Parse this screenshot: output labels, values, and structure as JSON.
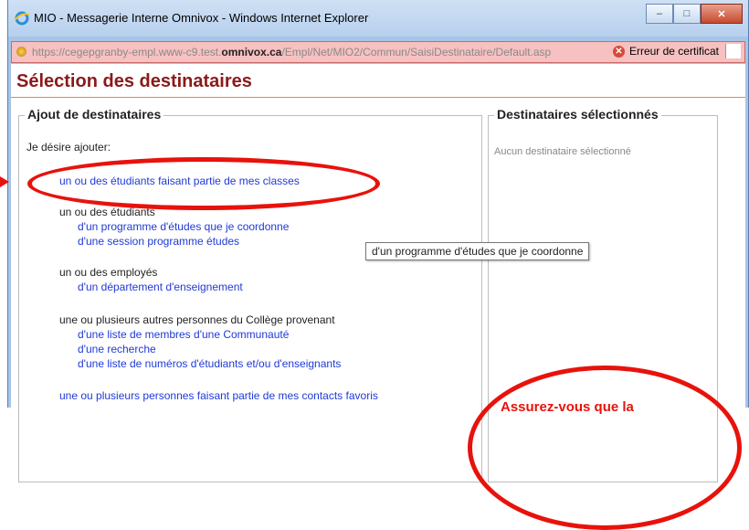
{
  "window": {
    "title": "MIO - Messagerie Interne Omnivox - Windows Internet Explorer",
    "controls": {
      "minimize": "–",
      "maximize": "□",
      "close": "✕"
    }
  },
  "address_bar": {
    "url_prefix": "https://cegepgranby-empl.www-c9.test.",
    "url_domain": "omnivox.ca",
    "url_suffix": "/Empl/Net/MIO2/Commun/SaisiDestinataire/Default.asp",
    "certificate_error": "Erreur de certificat"
  },
  "page": {
    "title": "Sélection des destinataires"
  },
  "left_panel": {
    "legend": "Ajout de destinataires",
    "intro": "Je désire ajouter:",
    "options": {
      "classes": "un ou des étudiants faisant partie de mes classes",
      "students_header": "un ou des étudiants",
      "students_links": [
        "d'un programme d'études que je coordonne",
        "d'une session programme études"
      ],
      "employees_header": "un ou des employés",
      "employees_links": [
        "d'un département d'enseignement"
      ],
      "others_header": "une ou plusieurs autres personnes du Collège provenant",
      "others_links": [
        "d'une liste de membres d'une Communauté",
        "d'une recherche",
        "d'une liste de numéros d'étudiants et/ou d'enseignants"
      ],
      "favorites": "une ou plusieurs personnes faisant partie de mes contacts favoris"
    }
  },
  "right_panel": {
    "legend": "Destinataires sélectionnés",
    "empty_text": "Aucun destinataire sélectionné"
  },
  "tooltip": "d'un programme d'études que je coordonne",
  "annotation": {
    "text": "Assurez-vous que la",
    "color": "#e8120c"
  },
  "colors": {
    "title": "#8b1a1a",
    "link": "#1f3ad6",
    "cert_bar": "#f6c1c0"
  }
}
